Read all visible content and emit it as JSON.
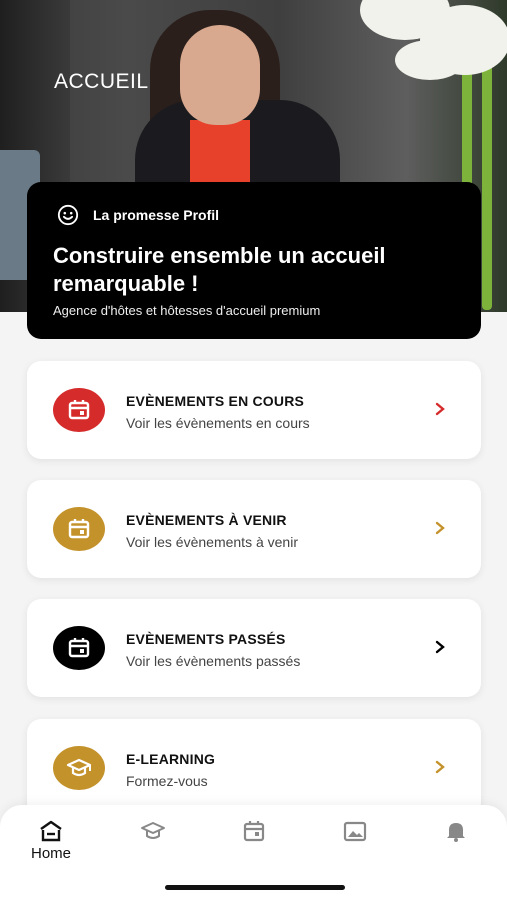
{
  "hero": {
    "title": "ACCUEIL"
  },
  "promo": {
    "icon": "smile-icon",
    "heading": "La promesse Profil",
    "title": "Construire ensemble un accueil remarquable !",
    "subtitle": "Agence d'hôtes et hôtesses d'accueil premium"
  },
  "cards": [
    {
      "title": "EVÈNEMENTS EN COURS",
      "subtitle": "Voir les évènements en cours",
      "icon": "calendar-icon",
      "color": "#d52b2b"
    },
    {
      "title": "EVÈNEMENTS À VENIR",
      "subtitle": "Voir les évènements à venir",
      "icon": "calendar-icon",
      "color": "#c4922b"
    },
    {
      "title": "EVÈNEMENTS PASSÉS",
      "subtitle": "Voir les évènements passés",
      "icon": "calendar-icon",
      "color": "#000000"
    },
    {
      "title": "E-LEARNING",
      "subtitle": "Formez-vous",
      "icon": "graduation-cap-icon",
      "color": "#c4922b"
    }
  ],
  "tabbar": {
    "items": [
      {
        "label": "Home",
        "icon": "home-icon",
        "active": true
      },
      {
        "label": "",
        "icon": "graduation-cap-icon",
        "active": false
      },
      {
        "label": "",
        "icon": "calendar-icon",
        "active": false
      },
      {
        "label": "",
        "icon": "image-icon",
        "active": false
      },
      {
        "label": "",
        "icon": "bell-icon",
        "active": false
      }
    ]
  }
}
